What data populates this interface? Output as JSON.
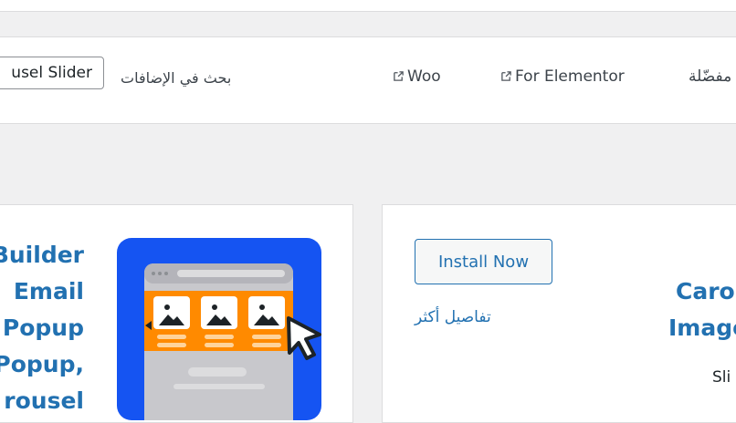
{
  "filter_bar": {
    "search_value": "usel Slider",
    "search_label": "بحث في الإضافات",
    "tabs": [
      {
        "label": "Woo"
      },
      {
        "label": "For Elementor"
      },
      {
        "label": "مفضّلة"
      }
    ]
  },
  "cards": [
    {
      "title_lines": [
        "Builder",
        "Email",
        "Popup",
        "Popup,",
        "rousel"
      ]
    },
    {
      "install_label": "Install Now",
      "more_details": "تفاصيل أكثر",
      "title_lines": [
        "Caro",
        "Image"
      ],
      "description_fragment": "Sli"
    }
  ],
  "colors": {
    "link": "#2271b1",
    "thumb_bg": "#1554f2",
    "thumb_band": "#ff8a00"
  }
}
